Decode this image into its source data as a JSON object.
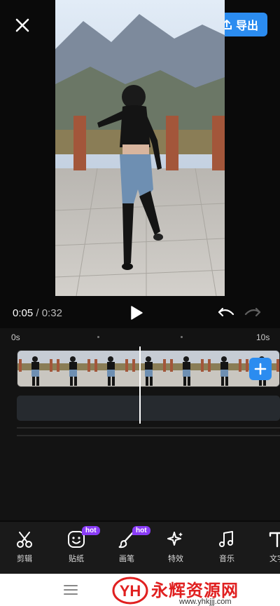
{
  "header": {
    "export_label": "导出"
  },
  "playback": {
    "current_time": "0:05",
    "separator": " / ",
    "total_time": "0:32"
  },
  "timeline": {
    "start_label": "0s",
    "end_label": "10s",
    "clip_frames": 7
  },
  "toolbar": {
    "items": [
      {
        "label": "剪辑",
        "icon": "scissors-icon",
        "hot": ""
      },
      {
        "label": "贴纸",
        "icon": "sticker-icon",
        "hot": "hot"
      },
      {
        "label": "画笔",
        "icon": "brush-icon",
        "hot": "hot"
      },
      {
        "label": "特效",
        "icon": "sparkle-icon",
        "hot": ""
      },
      {
        "label": "音乐",
        "icon": "music-icon",
        "hot": ""
      },
      {
        "label": "文字",
        "icon": "text-icon",
        "hot": ""
      }
    ]
  },
  "watermark": {
    "title": "永辉资源网",
    "url": "www.yhkjjj.com",
    "logo": "YH"
  },
  "colors": {
    "accent": "#2b8cf0",
    "hot_badge": "#8a3cf7",
    "watermark": "#e02020"
  }
}
